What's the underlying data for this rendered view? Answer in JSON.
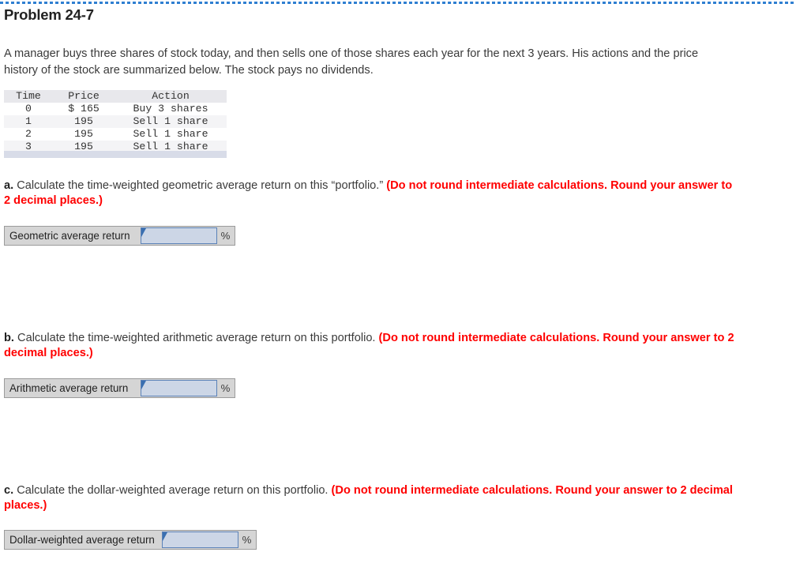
{
  "page": {
    "title": "Problem 24-7",
    "intro": "A manager buys three shares of stock today, and then sells one of those shares each year for the next 3 years. His actions and the price history of the stock are summarized below. The stock pays no dividends.",
    "accent_blue": "#2f7fd1",
    "emphasis_red": "#ff0000"
  },
  "table": {
    "headers": [
      "Time",
      "Price",
      "Action"
    ],
    "rows": [
      {
        "time": "0",
        "price": "$ 165",
        "action": "Buy 3 shares"
      },
      {
        "time": "1",
        "price": "195",
        "action": "Sell 1 share"
      },
      {
        "time": "2",
        "price": "195",
        "action": "Sell 1 share"
      },
      {
        "time": "3",
        "price": "195",
        "action": "Sell 1 share"
      }
    ]
  },
  "questions": [
    {
      "letter": "a.",
      "text": " Calculate the time-weighted geometric average return on this “portfolio.” ",
      "emphasis": "(Do not round intermediate calculations. Round your answer to 2 decimal places.)",
      "answer": {
        "label": "Geometric average return",
        "value": "",
        "placeholder": "",
        "unit": "%"
      }
    },
    {
      "letter": "b.",
      "text": " Calculate the time-weighted arithmetic average return on this portfolio. ",
      "emphasis": "(Do not round intermediate calculations. Round your answer to 2 decimal places.)",
      "answer": {
        "label": "Arithmetic average return",
        "value": "",
        "placeholder": "",
        "unit": "%"
      }
    },
    {
      "letter": "c.",
      "text": " Calculate the dollar-weighted average return on this portfolio. ",
      "emphasis": "(Do not round intermediate calculations. Round your answer to 2 decimal places.)",
      "answer": {
        "label": "Dollar-weighted average return",
        "value": "",
        "placeholder": "",
        "unit": "%"
      }
    }
  ]
}
